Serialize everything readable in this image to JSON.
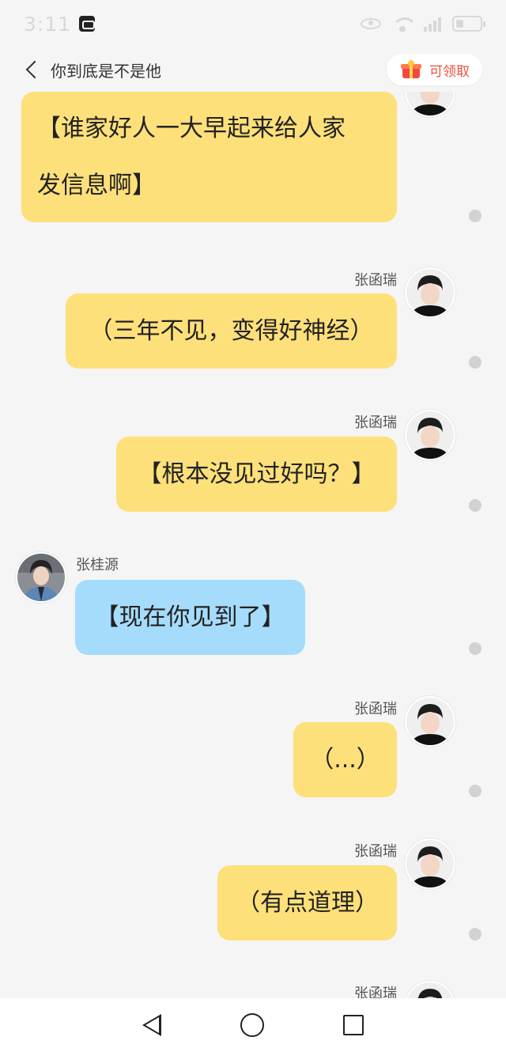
{
  "status_bar": {
    "time": "3:11",
    "icons": [
      "app-notification-icon",
      "eye-icon",
      "wifi-icon",
      "signal-icon",
      "battery-icon"
    ]
  },
  "header": {
    "title": "你到底是不是他",
    "back_icon": "chevron-left-icon",
    "claim_button": {
      "label": "可领取",
      "icon": "gift-icon"
    }
  },
  "messages": [
    {
      "sender": "",
      "side": "right",
      "text_line1": "【谁家好人一大早起来给人家",
      "text_line2": "发信息啊】",
      "color": "yellow"
    },
    {
      "sender": "张函瑞",
      "side": "right",
      "text": "（三年不见，变得好神经）",
      "color": "yellow"
    },
    {
      "sender": "张函瑞",
      "side": "right",
      "text": "【根本没见过好吗？】",
      "color": "yellow"
    },
    {
      "sender": "张桂源",
      "side": "left",
      "text": "【现在你见到了】",
      "color": "blue"
    },
    {
      "sender": "张函瑞",
      "side": "right",
      "text": "（...）",
      "color": "yellow"
    },
    {
      "sender": "张函瑞",
      "side": "right",
      "text": "（有点道理）",
      "color": "yellow"
    },
    {
      "sender": "张函瑞",
      "side": "right",
      "text": "",
      "color": "yellow"
    }
  ],
  "nav_bar": {
    "icons": [
      "back-triangle-icon",
      "home-circle-icon",
      "recents-square-icon"
    ]
  },
  "colors": {
    "bubble_yellow": "#fee07a",
    "bubble_blue": "#a6dcfb",
    "background": "#f5f5f5",
    "claim_text": "#e6533f"
  }
}
